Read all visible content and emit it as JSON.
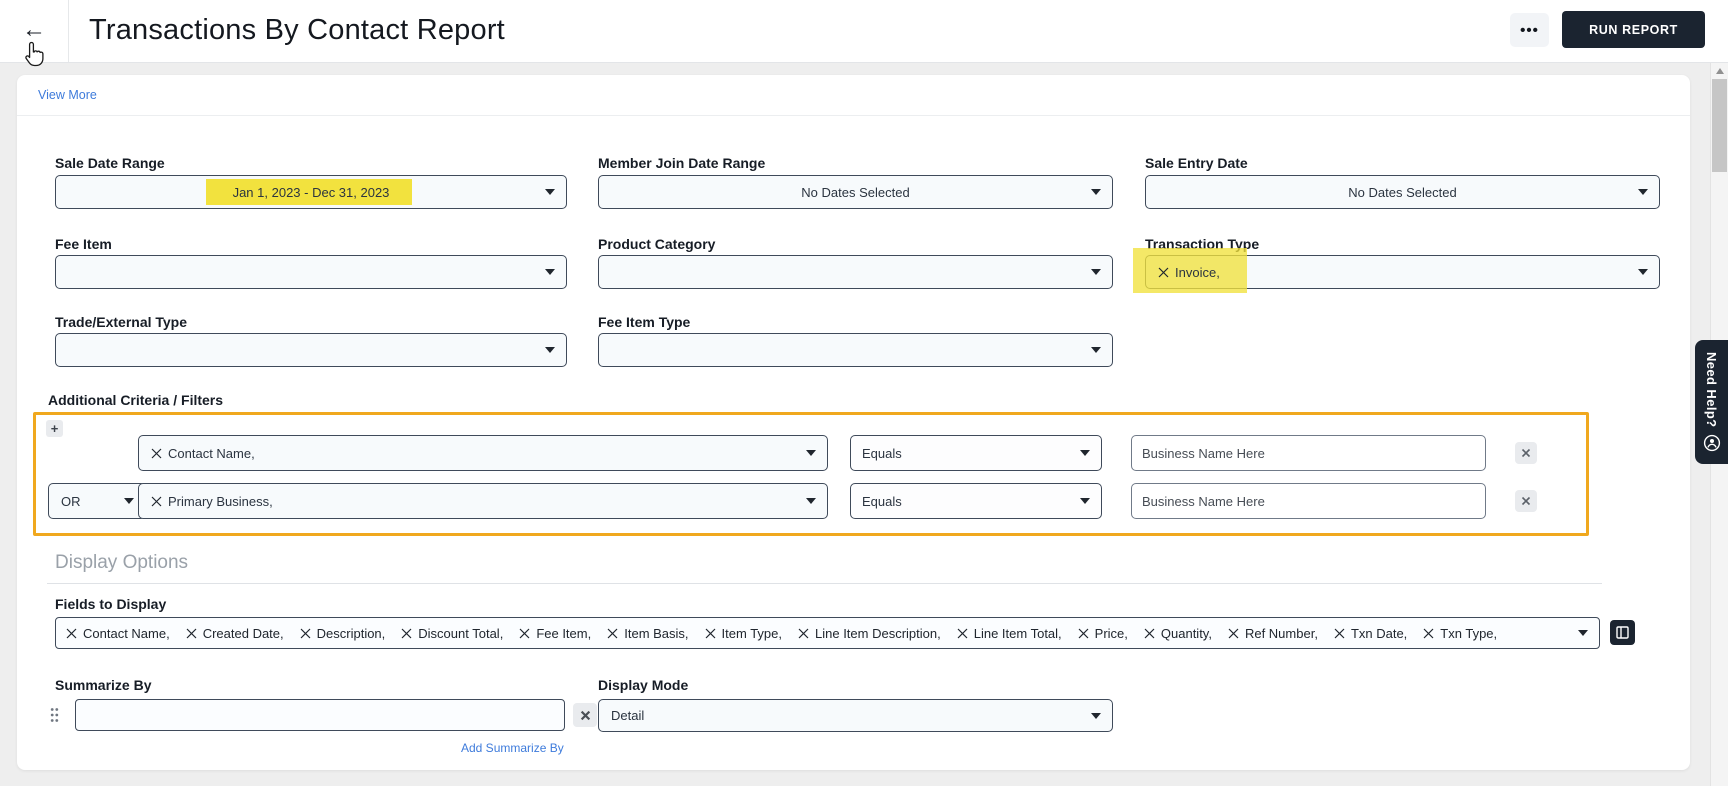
{
  "header": {
    "title": "Transactions By Contact Report",
    "more_label": "•••",
    "run_report_label": "RUN REPORT"
  },
  "links": {
    "view_more": "View More"
  },
  "filters": {
    "sale_date_range": {
      "label": "Sale Date Range",
      "value": "Jan 1, 2023 - Dec 31, 2023",
      "highlighted": true
    },
    "member_join_date_range": {
      "label": "Member Join Date Range",
      "value": "No Dates Selected"
    },
    "sale_entry_date": {
      "label": "Sale Entry Date",
      "value": "No Dates Selected"
    },
    "fee_item": {
      "label": "Fee Item",
      "value": ""
    },
    "product_category": {
      "label": "Product Category",
      "value": ""
    },
    "transaction_type": {
      "label": "Transaction Type",
      "chip": "Invoice,",
      "highlighted": true
    },
    "trade_external_type": {
      "label": "Trade/External Type",
      "value": ""
    },
    "fee_item_type": {
      "label": "Fee Item Type",
      "value": ""
    }
  },
  "criteria": {
    "label": "Additional Criteria / Filters",
    "add_button": "+",
    "rows": [
      {
        "operator": "",
        "field": "Contact Name,",
        "comparison": "Equals",
        "value": "Business Name Here"
      },
      {
        "operator": "OR",
        "field": "Primary Business,",
        "comparison": "Equals",
        "value": "Business Name Here"
      }
    ]
  },
  "display_options": {
    "heading": "Display Options",
    "fields_to_display": {
      "label": "Fields to Display",
      "chips": [
        "Contact Name,",
        "Created Date,",
        "Description,",
        "Discount Total,",
        "Fee Item,",
        "Item Basis,",
        "Item Type,",
        "Line Item Description,",
        "Line Item Total,",
        "Price,",
        "Quantity,",
        "Ref Number,",
        "Txn Date,",
        "Txn Type,"
      ]
    },
    "summarize_by": {
      "label": "Summarize By",
      "value": "",
      "add_link": "Add Summarize By"
    },
    "display_mode": {
      "label": "Display Mode",
      "value": "Detail"
    }
  },
  "help_tab": {
    "label": "Need Help?"
  },
  "colors": {
    "highlight_yellow": "#f2e23e",
    "criteria_outline": "#f0a81e",
    "primary_button": "#1b2430",
    "link_blue": "#3e7bdb",
    "select_bg": "#f7fafc",
    "select_border": "#3f4a5a"
  }
}
